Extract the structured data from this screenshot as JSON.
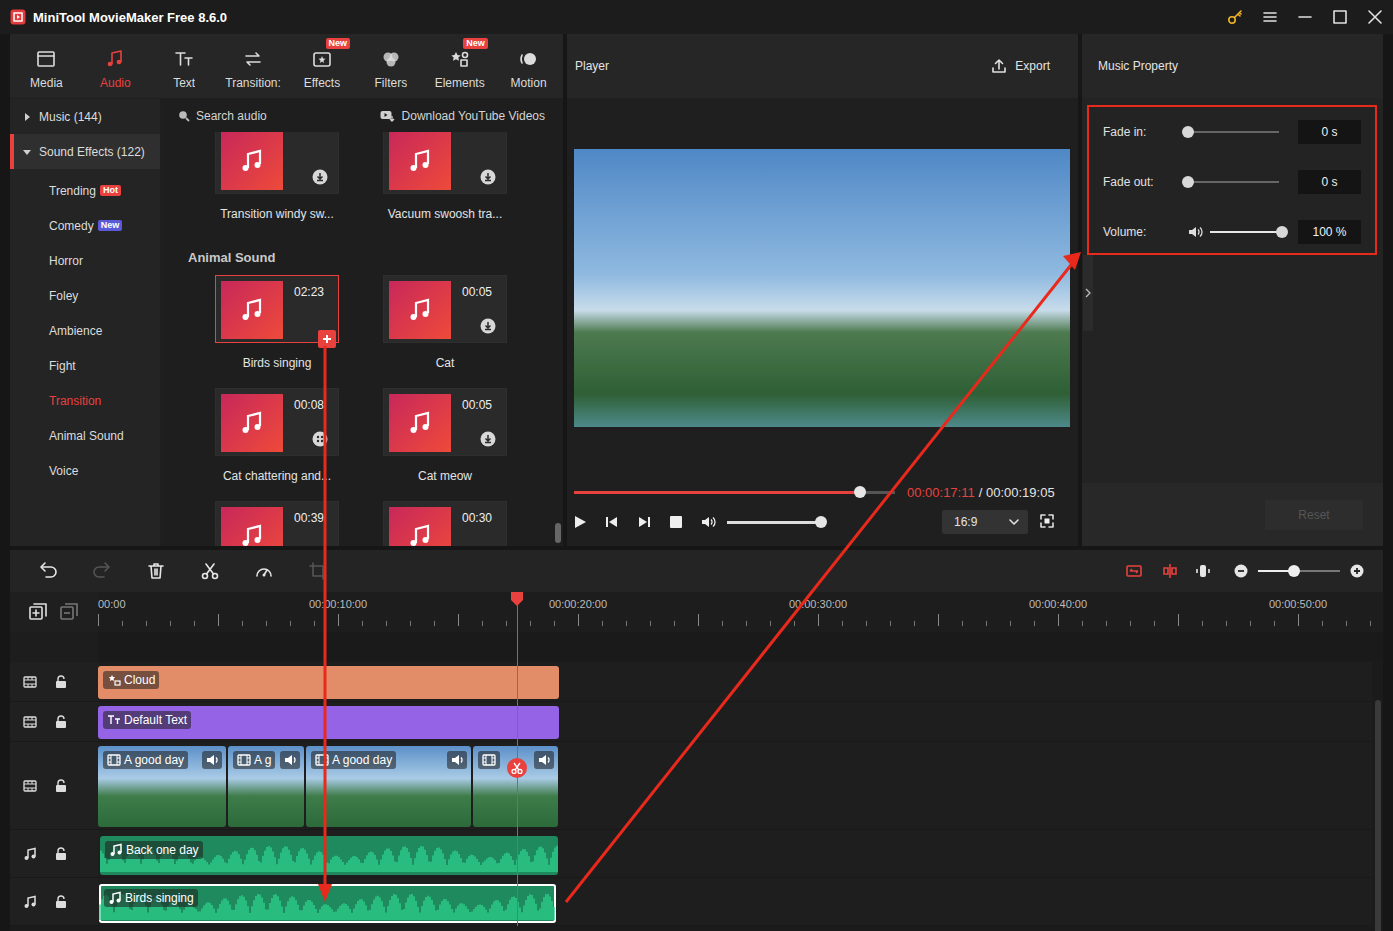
{
  "window": {
    "title": "MiniTool MovieMaker Free 8.6.0"
  },
  "toolbar_tabs": [
    {
      "label": "Media",
      "selected": false
    },
    {
      "label": "Audio",
      "selected": true
    },
    {
      "label": "Text",
      "selected": false
    },
    {
      "label": "Transition:",
      "selected": false
    },
    {
      "label": "Effects",
      "selected": false,
      "badge": "New"
    },
    {
      "label": "Filters",
      "selected": false
    },
    {
      "label": "Elements",
      "selected": false,
      "badge": "New"
    },
    {
      "label": "Motion",
      "selected": false
    }
  ],
  "categories": [
    {
      "label": "Music (144)",
      "expanded": false,
      "selected": false
    },
    {
      "label": "Sound Effects (122)",
      "expanded": true,
      "selected": true
    }
  ],
  "subcategories": [
    {
      "label": "Trending",
      "selected": false,
      "badge": {
        "text": "Hot",
        "color": "#e8413e"
      }
    },
    {
      "label": "Comedy",
      "selected": false,
      "badge": {
        "text": "New",
        "color": "#5a5ad8"
      }
    },
    {
      "label": "Horror",
      "selected": false
    },
    {
      "label": "Foley",
      "selected": false
    },
    {
      "label": "Ambience",
      "selected": false
    },
    {
      "label": "Fight",
      "selected": false
    },
    {
      "label": "Transition",
      "selected": true
    },
    {
      "label": "Animal Sound",
      "selected": false
    },
    {
      "label": "Voice",
      "selected": false
    }
  ],
  "search": {
    "placeholder": "Search audio"
  },
  "download_button": {
    "label": "Download YouTube Videos"
  },
  "library": {
    "partial_cards": [
      {
        "name": "Transition windy sw...",
        "action": "download",
        "selected": false
      },
      {
        "name": "Vacuum swoosh tra...",
        "action": "download",
        "selected": false
      }
    ],
    "section": {
      "title": "Animal Sound",
      "cards": [
        {
          "name": "Birds singing",
          "duration": "02:23",
          "action": "add",
          "selected": true
        },
        {
          "name": "Cat",
          "duration": "00:05",
          "action": "download",
          "selected": false
        },
        {
          "name": "Cat chattering and...",
          "duration": "00:08",
          "action": "loading",
          "selected": false
        },
        {
          "name": "Cat meow",
          "duration": "00:05",
          "action": "download",
          "selected": false
        },
        {
          "duration": "00:39",
          "selected": false
        },
        {
          "duration": "00:30",
          "selected": false
        }
      ]
    },
    "scroll": 0.9
  },
  "player": {
    "title": "Player",
    "export": "Export",
    "current_time": "00:00:17:11",
    "total_time": "/ 00:00:19:05",
    "progress": 0.89,
    "volume": 1,
    "aspect_ratio": "16:9",
    "playing": false
  },
  "property": {
    "title": "Music Property",
    "highlighted": true,
    "rows": [
      {
        "kind": "fade",
        "label": "Fade in:",
        "level": 0,
        "value": "0 s"
      },
      {
        "kind": "fade",
        "label": "Fade out:",
        "level": 0,
        "value": "0 s"
      },
      {
        "kind": "volume",
        "label": "Volume:",
        "level": 1,
        "value": "100 %"
      }
    ],
    "reset": {
      "label": "Reset",
      "disabled": true
    }
  },
  "timeline": {
    "tools": [
      {
        "kind": "undo",
        "disabled": false
      },
      {
        "kind": "redo",
        "disabled": true
      },
      {
        "kind": "delete",
        "disabled": false
      },
      {
        "kind": "split",
        "disabled": false
      },
      {
        "kind": "speed",
        "disabled": false
      },
      {
        "kind": "crop",
        "disabled": true
      }
    ],
    "zoom": 0.44,
    "ruler": [
      "00:00",
      "00:00:10:00",
      "00:00:20:00",
      "00:00:30:00",
      "00:00:40:00",
      "00:00:50:00"
    ],
    "playhead_seconds": 17.46,
    "tracks": [
      {
        "kind": "element",
        "locked": false,
        "clips": [
          {
            "label": "Cloud",
            "start": 0,
            "end": 19.2,
            "selected": false
          }
        ]
      },
      {
        "kind": "text",
        "locked": false,
        "clips": [
          {
            "label": "Default Text",
            "start": 0,
            "end": 19.2,
            "selected": false
          }
        ]
      },
      {
        "kind": "video",
        "locked": false,
        "clips": [
          {
            "label": "A good day",
            "start": 0,
            "end": 5.33,
            "selected": false
          },
          {
            "label": "A g",
            "start": 5.42,
            "end": 8.58,
            "selected": false
          },
          {
            "label": "A good day",
            "start": 8.67,
            "end": 15.54,
            "selected": false
          },
          {
            "start": 15.63,
            "end": 19.17,
            "selected": false
          }
        ]
      },
      {
        "kind": "audio",
        "locked": false,
        "clips": [
          {
            "label": "Back one day",
            "start": 0.08,
            "end": 19.17,
            "selected": false
          }
        ]
      },
      {
        "kind": "audio",
        "locked": false,
        "clips": [
          {
            "label": "Birds singing",
            "start": 0.04,
            "end": 19.08,
            "selected": true
          }
        ]
      }
    ]
  }
}
